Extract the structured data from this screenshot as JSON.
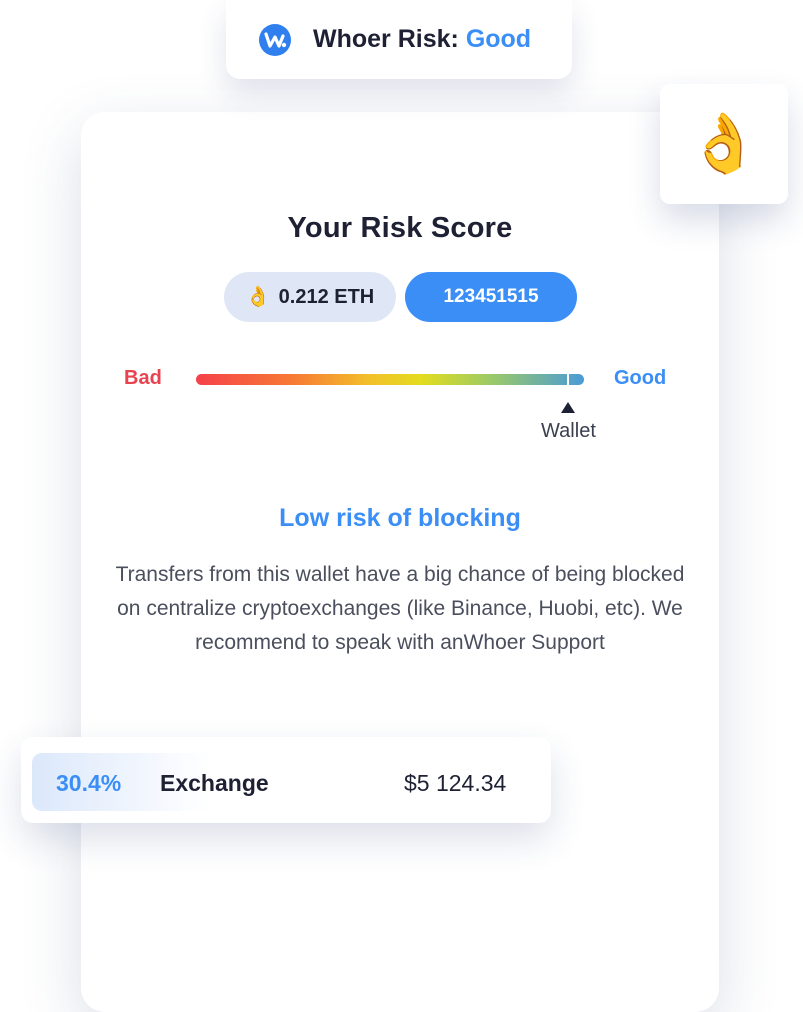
{
  "badge": {
    "label": "Whoer Risk:",
    "value": "Good",
    "logo_icon": "whoer-logo-icon"
  },
  "reaction": {
    "emoji": "👌",
    "icon": "ok-hand-icon"
  },
  "score": {
    "title": "Your Risk Score",
    "balance_emoji": "👌",
    "balance": "0.212 ETH",
    "wallet_id": "123451515"
  },
  "scale": {
    "bad_label": "Bad",
    "good_label": "Good",
    "pointer_label": "Wallet",
    "position_fraction": 0.96
  },
  "risk": {
    "heading": "Low risk of blocking",
    "description": "Transfers from this wallet have a big chance of being blocked on centralize cryptoexchanges (like Binance, Huobi, etc). We recommend to speak with anWhoer Support"
  },
  "exchange": {
    "percent": "30.4%",
    "name": "Exchange",
    "amount": "$5 124.34"
  },
  "colors": {
    "accent": "#3a8ef6",
    "bad": "#e9434f",
    "text": "#1d2133"
  }
}
